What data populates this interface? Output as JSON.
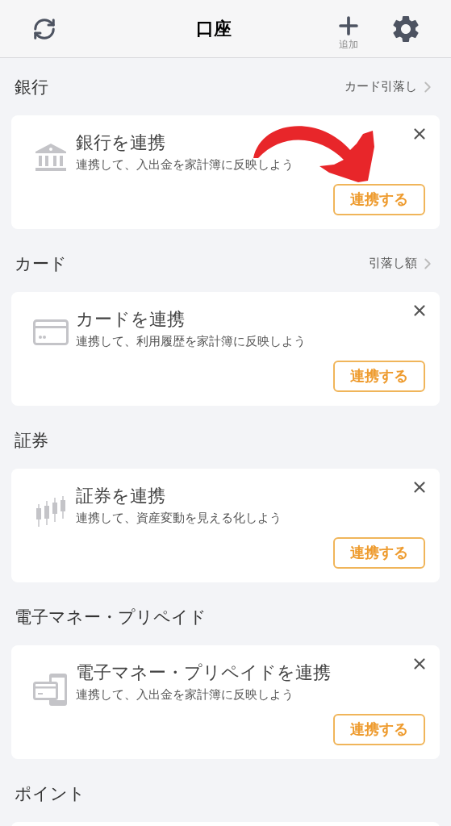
{
  "header": {
    "title": "口座",
    "add_label": "追加"
  },
  "sections": [
    {
      "heading": "銀行",
      "link": "カード引落し",
      "card": {
        "kind": "bank",
        "title": "銀行を連携",
        "description": "連携して、入出金を家計簿に反映しよう",
        "button": "連携する"
      }
    },
    {
      "heading": "カード",
      "link": "引落し額",
      "card": {
        "kind": "card",
        "title": "カードを連携",
        "description": "連携して、利用履歴を家計簿に反映しよう",
        "button": "連携する"
      }
    },
    {
      "heading": "証券",
      "card": {
        "kind": "chart",
        "title": "証券を連携",
        "description": "連携して、資産変動を見える化しよう",
        "button": "連携する"
      }
    },
    {
      "heading": "電子マネー・プリペイド",
      "card": {
        "kind": "phone",
        "title": "電子マネー・プリペイドを連携",
        "description": "連携して、入出金を家計簿に反映しよう",
        "button": "連携する"
      }
    },
    {
      "heading": "ポイント"
    }
  ]
}
